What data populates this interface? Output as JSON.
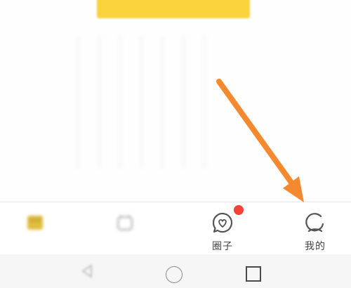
{
  "content": {
    "yellow_button_label": ""
  },
  "tabbar": {
    "tabs": [
      {
        "label": "",
        "icon": "home-icon"
      },
      {
        "label": "",
        "icon": "category-icon"
      },
      {
        "label": "圈子",
        "icon": "heart-chat-icon",
        "has_badge": true
      },
      {
        "label": "我的",
        "icon": "profile-icon"
      }
    ]
  },
  "navigation": {
    "back": "back-triangle-icon",
    "home": "home-circle-icon",
    "recents": "recents-square-icon"
  },
  "colors": {
    "accent_yellow": "#f8d33b",
    "badge_red": "#f44336",
    "annotation_orange": "#f5892f",
    "tab_text": "#444444"
  }
}
